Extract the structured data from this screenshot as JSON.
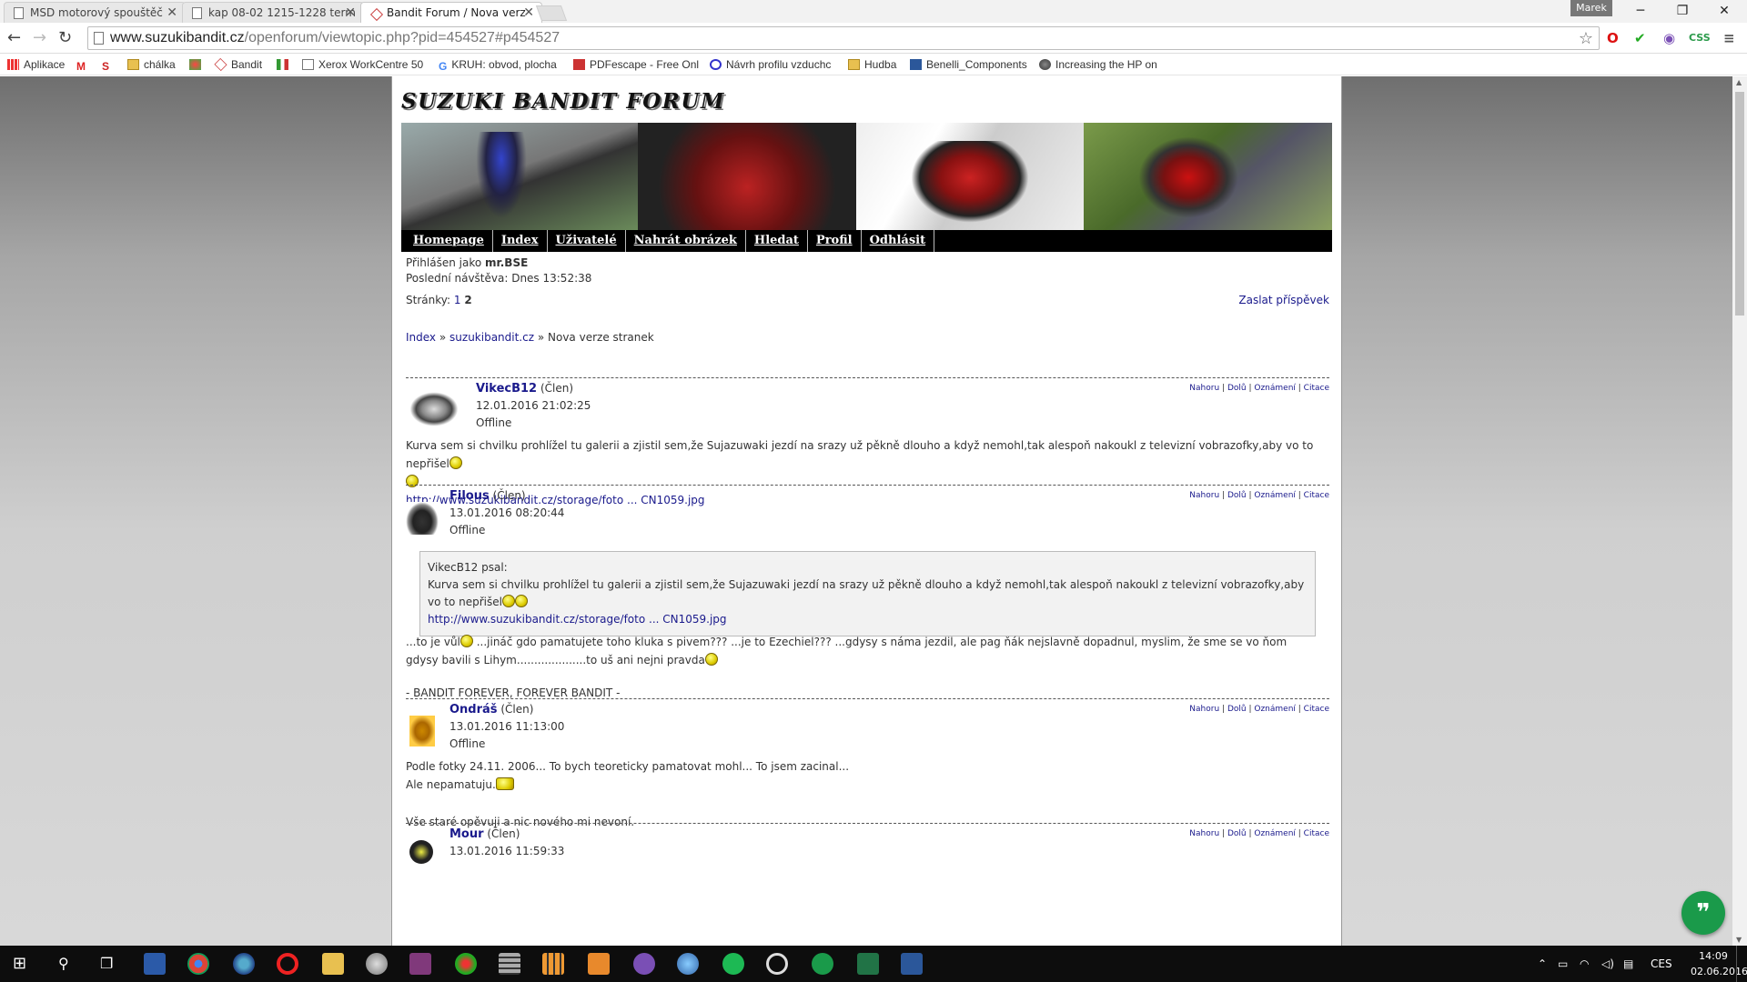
{
  "browser": {
    "tabs": [
      {
        "label": "MSD motorový spouštěč",
        "active": false
      },
      {
        "label": "kap 08-02 1215-1228 term",
        "active": false
      },
      {
        "label": "Bandit Forum / Nova verz",
        "active": true
      }
    ],
    "user": "Marek",
    "url_domain": "www.suzukibandit.cz",
    "url_path": "/openforum/viewtopic.php?pid=454527#p454527",
    "bookmarks": [
      "Aplikace",
      "chálka",
      "Bandit",
      "Xerox WorkCentre 50",
      "KRUH: obvod, plocha",
      "PDFescape - Free Onl",
      "Návrh profilu vzduchc",
      "Hudba",
      "Benelli_Components",
      "Increasing the HP on"
    ],
    "ext_css": "CSS"
  },
  "forum": {
    "title": "SUZUKI BANDIT FORUM",
    "nav": [
      "Homepage",
      "Index",
      "Uživatelé",
      "Nahrát obrázek",
      "Hledat",
      "Profil",
      "Odhlásit"
    ],
    "logged_prefix": "Přihlášen jako",
    "logged_user": "mr.BSE",
    "last_visit": "Poslední návštěva: Dnes 13:52:38",
    "pages_label": "Stránky:",
    "page1": "1",
    "page2": "2",
    "reply": "Zaslat příspěvek",
    "crumb": {
      "index": "Index",
      "sep": " » ",
      "forum": "suzukibandit.cz",
      "topic": "Nova verze stranek"
    },
    "actions": {
      "up": "Nahoru",
      "down": "Dolů",
      "report": "Oznámení",
      "quote": "Citace",
      "sep": " | "
    },
    "posts": [
      {
        "author": "VikecB12",
        "role": "(Člen)",
        "date": "12.01.2016 21:02:25",
        "status": "Offline",
        "text": "Kurva sem si chvilku prohlížel tu galerii a zjistil sem,že Sujazuwaki jezdí na srazy už pěkně dlouho a když nemohl,tak alespoň nakoukl z televizní vobrazofky,aby vo to nepřišel",
        "link": "http://www.suzukibandit.cz/storage/foto ... CN1059.jpg"
      },
      {
        "author": "Filous",
        "role": "(Člen)",
        "date": "13.01.2016 08:20:44",
        "status": "Offline",
        "quote_head": "VikecB12 psal:",
        "quote_text": "Kurva sem si chvilku prohlížel tu galerii a zjistil sem,že Sujazuwaki jezdí na srazy už pěkně dlouho a když nemohl,tak alespoň nakoukl z televizní vobrazofky,aby vo to nepřišel",
        "quote_link": "http://www.suzukibandit.cz/storage/foto ... CN1059.jpg",
        "text1": "...to je vůl",
        "text2": " ...jináč gdo pamatujete toho kluka s pivem??? ...je to Ezechiel??? ...gdysy s náma jezdil, ale pag ňák nejslavně dopadnul, myslim, že sme se vo ňom gdysy bavili s Lihym....................to uš ani nejni pravda",
        "signature": "- BANDIT FOREVER, FOREVER BANDIT -"
      },
      {
        "author": "Ondráš",
        "role": "(Člen)",
        "date": "13.01.2016 11:13:00",
        "status": "Offline",
        "line1": "Podle fotky 24.11. 2006... To bych teoreticky pamatovat mohl... To jsem zacinal...",
        "line2": "Ale nepamatuju.",
        "signature": "Vše staré opěvuji a nic nového mi nevoní."
      },
      {
        "author": "Mour",
        "role": "(Člen)",
        "date": "13.01.2016 11:59:33"
      }
    ]
  },
  "system": {
    "clock_time": "14:09",
    "clock_date": "02.06.2016",
    "lang": "CES"
  },
  "colors": {
    "link": "#1a1a8c",
    "fab": "#1a9a4a"
  }
}
